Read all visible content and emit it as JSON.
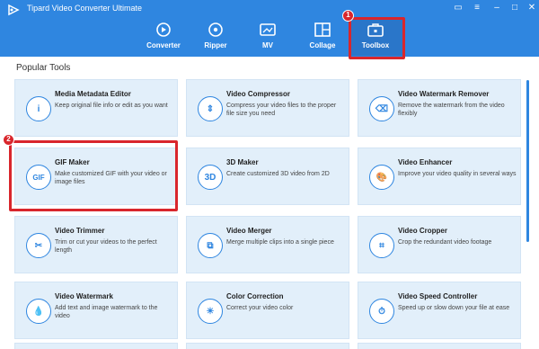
{
  "app": {
    "title": "Tipard Video Converter Ultimate"
  },
  "nav": [
    {
      "id": "converter",
      "label": "Converter",
      "icon": "converter-icon"
    },
    {
      "id": "ripper",
      "label": "Ripper",
      "icon": "ripper-icon"
    },
    {
      "id": "mv",
      "label": "MV",
      "icon": "mv-icon"
    },
    {
      "id": "collage",
      "label": "Collage",
      "icon": "collage-icon"
    },
    {
      "id": "toolbox",
      "label": "Toolbox",
      "icon": "toolbox-icon",
      "active": true
    }
  ],
  "annotations": {
    "step1": "1",
    "step2": "2"
  },
  "content": {
    "section_title": "Popular Tools",
    "tools": [
      {
        "title": "Media Metadata Editor",
        "desc": "Keep original file info or edit as you want",
        "icon": "info-icon",
        "glyph": "i"
      },
      {
        "title": "Video Compressor",
        "desc": "Compress your video files to the proper file size you need",
        "icon": "compress-icon",
        "glyph": "⇕"
      },
      {
        "title": "Video Watermark Remover",
        "desc": "Remove the watermark from the video flexibly",
        "icon": "watermark-remover-icon",
        "glyph": "⌫"
      },
      {
        "title": "GIF Maker",
        "desc": "Make customized GIF with your video or image files",
        "icon": "gif-icon",
        "glyph": "GIF"
      },
      {
        "title": "3D Maker",
        "desc": "Create customized 3D video from 2D",
        "icon": "3d-icon",
        "glyph": "3D"
      },
      {
        "title": "Video Enhancer",
        "desc": "Improve your video quality in several ways",
        "icon": "palette-icon",
        "glyph": "🎨"
      },
      {
        "title": "Video Trimmer",
        "desc": "Trim or cut your videos to the perfect length",
        "icon": "scissors-icon",
        "glyph": "✂"
      },
      {
        "title": "Video Merger",
        "desc": "Merge multiple clips into a single piece",
        "icon": "merge-icon",
        "glyph": "⧉"
      },
      {
        "title": "Video Cropper",
        "desc": "Crop the redundant video footage",
        "icon": "crop-icon",
        "glyph": "⌗"
      },
      {
        "title": "Video Watermark",
        "desc": "Add text and image watermark to the video",
        "icon": "drop-icon",
        "glyph": "💧"
      },
      {
        "title": "Color Correction",
        "desc": "Correct your video color",
        "icon": "sun-icon",
        "glyph": "☀"
      },
      {
        "title": "Video Speed Controller",
        "desc": "Speed up or slow down your file at ease",
        "icon": "speed-icon",
        "glyph": "⏱"
      }
    ]
  },
  "colors": {
    "brand": "#2f86e0",
    "highlight": "#d9262c",
    "card_bg": "#e2effa"
  }
}
